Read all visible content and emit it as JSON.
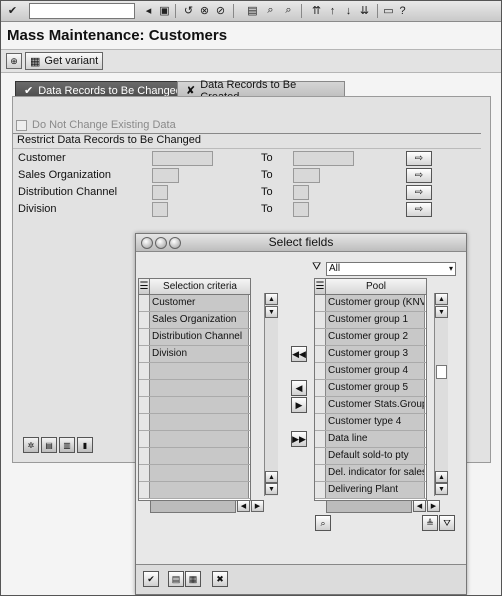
{
  "title": "Mass Maintenance: Customers",
  "toolbar": {
    "icons": [
      "check-icon",
      "back-icon",
      "save-icon",
      "back-nav-icon",
      "exit-icon",
      "cancel-icon",
      "print-icon",
      "find-icon",
      "find-next-icon",
      "first-page-icon",
      "prev-page-icon",
      "next-page-icon",
      "last-page-icon",
      "window-icon",
      "help-icon"
    ]
  },
  "appbar": {
    "get_variant": "Get variant"
  },
  "tabs": {
    "changed": "Data Records to Be Changed",
    "created": "Data Records to Be Created"
  },
  "no_change_label": "Do Not Change Existing Data",
  "restrict_title": "Restrict Data Records to Be Changed",
  "restrict_rows": [
    {
      "label": "Customer",
      "to": "To"
    },
    {
      "label": "Sales Organization",
      "to": "To"
    },
    {
      "label": "Distribution Channel",
      "to": "To"
    },
    {
      "label": "Division",
      "to": "To"
    }
  ],
  "dialog": {
    "title": "Select fields",
    "filter_value": "All",
    "left_header": "Selection criteria",
    "left_rows": [
      "Customer",
      "Sales Organization",
      "Distribution Channel",
      "Division",
      "",
      "",
      "",
      "",
      "",
      "",
      "",
      ""
    ],
    "right_header": "Pool",
    "right_rows": [
      "Customer group (KNVV-",
      "Customer group 1",
      "Customer group 2",
      "Customer group 3",
      "Customer group 4",
      "Customer group 5",
      "Customer Stats.Group",
      "Customer type 4",
      "Data line",
      "Default sold-to pty",
      "Del. indicator for sales ...",
      "Delivering Plant"
    ]
  }
}
